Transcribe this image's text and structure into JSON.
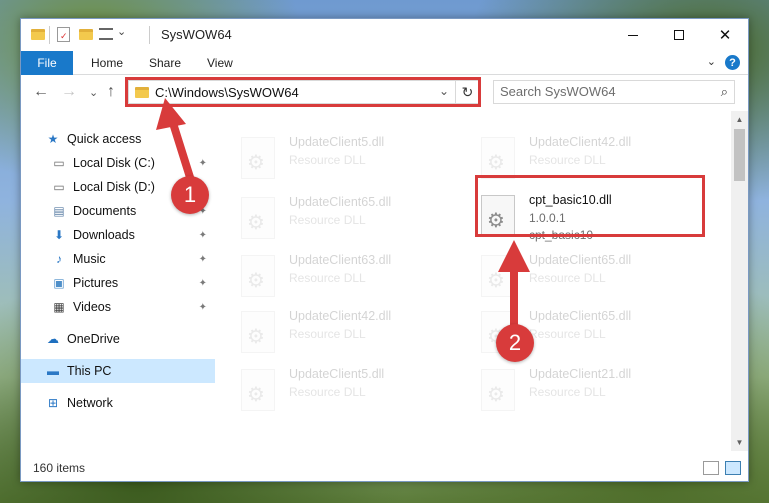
{
  "window": {
    "title": "SysWOW64",
    "controls": {
      "minimize": "—",
      "maximize": "",
      "close": "✕"
    }
  },
  "ribbon": {
    "file_tab": "File",
    "tabs": [
      "Home",
      "Share",
      "View"
    ],
    "expand": "⌄",
    "help": "?"
  },
  "navigation": {
    "back": "←",
    "forward": "→",
    "recent": "⌄",
    "up": "↑",
    "address": "C:\\Windows\\SysWOW64",
    "address_dropdown": "⌄",
    "refresh": "↻",
    "search_placeholder": "Search SysWOW64",
    "search_icon": "⌕"
  },
  "sidebar": {
    "items": [
      {
        "label": "Quick access",
        "icon": "star-icon",
        "glyph": "★",
        "color": "#2b78c5",
        "pinned": false
      },
      {
        "label": "Local Disk (C:)",
        "icon": "drive-icon",
        "glyph": "▭",
        "color": "#6b6b6b",
        "pinned": true
      },
      {
        "label": "Local Disk (D:)",
        "icon": "drive-icon",
        "glyph": "▭",
        "color": "#6b6b6b",
        "pinned": true
      },
      {
        "label": "Documents",
        "icon": "documents-icon",
        "glyph": "▤",
        "color": "#5c7fa6",
        "pinned": true
      },
      {
        "label": "Downloads",
        "icon": "download-icon",
        "glyph": "⬇",
        "color": "#2b78c5",
        "pinned": true
      },
      {
        "label": "Music",
        "icon": "music-icon",
        "glyph": "♪",
        "color": "#2b78c5",
        "pinned": true
      },
      {
        "label": "Pictures",
        "icon": "pictures-icon",
        "glyph": "▣",
        "color": "#4f8fc9",
        "pinned": true
      },
      {
        "label": "Videos",
        "icon": "video-icon",
        "glyph": "▦",
        "color": "#444444",
        "pinned": true
      },
      {
        "label": "OneDrive",
        "icon": "cloud-icon",
        "glyph": "☁",
        "color": "#1e6fbf",
        "pinned": false
      },
      {
        "label": "This PC",
        "icon": "computer-icon",
        "glyph": "▬",
        "color": "#2b78c5",
        "pinned": false,
        "selected": true
      },
      {
        "label": "Network",
        "icon": "network-icon",
        "glyph": "⊞",
        "color": "#2b78c5",
        "pinned": false
      }
    ],
    "pin_glyph": "📌"
  },
  "files": [
    {
      "name": "UpdateClient5.dll",
      "type": "Resource DLL",
      "highlight": false
    },
    {
      "name": "UpdateClient42.dll",
      "type": "Resource DLL",
      "highlight": false
    },
    {
      "name": "UpdateClient65.dll",
      "type": "Resource DLL",
      "highlight": false
    },
    {
      "name": "cpt_basic10.dll",
      "version": "1.0.0.1",
      "description": "cpt_basic10",
      "highlight": true
    },
    {
      "name": "UpdateClient63.dll",
      "type": "Resource DLL",
      "highlight": false
    },
    {
      "name": "UpdateClient65.dll",
      "type": "Resource DLL",
      "highlight": false
    },
    {
      "name": "UpdateClient42.dll",
      "type": "Resource DLL",
      "highlight": false
    },
    {
      "name": "UpdateClient65.dll",
      "type": "Resource DLL",
      "highlight": false
    },
    {
      "name": "UpdateClient5.dll",
      "type": "Resource DLL",
      "highlight": false
    },
    {
      "name": "UpdateClient21.dll",
      "type": "Resource DLL",
      "highlight": false
    }
  ],
  "status": {
    "item_count": "160 items"
  },
  "annotations": {
    "step1": "1",
    "step2": "2",
    "accent": "#d83b3b"
  }
}
